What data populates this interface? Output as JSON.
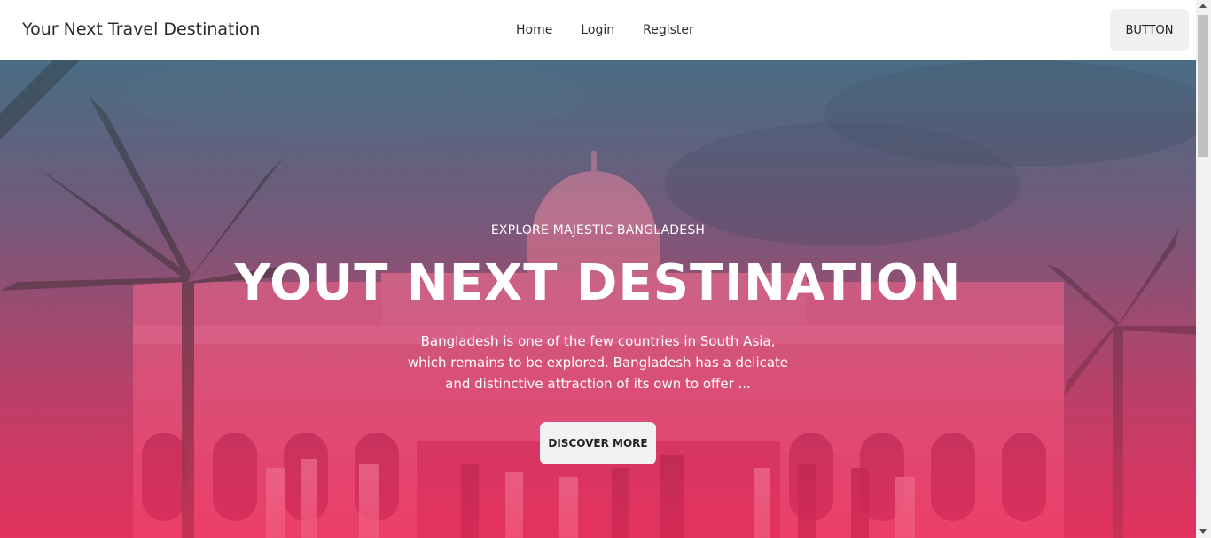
{
  "navbar": {
    "brand": "Your Next Travel Destination",
    "links": [
      "Home",
      "Login",
      "Register"
    ],
    "button_label": "BUTTON"
  },
  "hero": {
    "eyebrow": "EXPLORE MAJESTIC BANGLADESH",
    "headline": "YOUT NEXT DESTINATION",
    "description": "Bangladesh is one of the few countries in South Asia, which remains to be explored. Bangladesh has a delicate and distinctive attraction of its own to offer ...",
    "cta_label": "DISCOVER MORE",
    "image_subject": "ahsan-manzil-palace-photo"
  },
  "colors": {
    "overlay_top": "#46698a",
    "overlay_bottom": "#f02d5a",
    "button_bg": "#f0f0f0",
    "text_dark": "#2b2b2b"
  }
}
